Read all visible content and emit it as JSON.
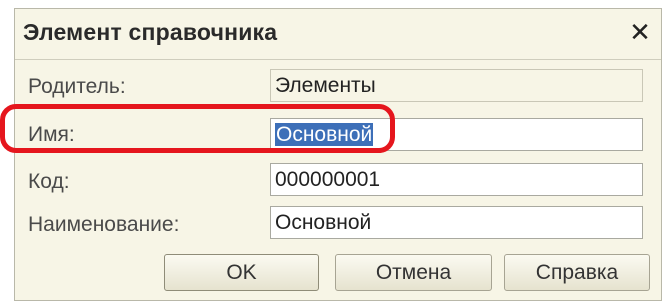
{
  "window": {
    "title": "Элемент справочника",
    "close_glyph": "✕"
  },
  "form": {
    "parent": {
      "label": "Родитель:",
      "value": "Элементы"
    },
    "name": {
      "label": "Имя:",
      "value": "Основной"
    },
    "code": {
      "label": "Код:",
      "value": "000000001"
    },
    "description": {
      "label": "Наименование:",
      "value": "Основной"
    }
  },
  "buttons": {
    "ok": "OK",
    "cancel": "Отмена",
    "help": "Справка"
  },
  "colors": {
    "dialog_bg": "#f7f5e6",
    "selection": "#3d6fb8",
    "highlight": "#e5161d"
  },
  "icons": {
    "close": "close-icon"
  }
}
